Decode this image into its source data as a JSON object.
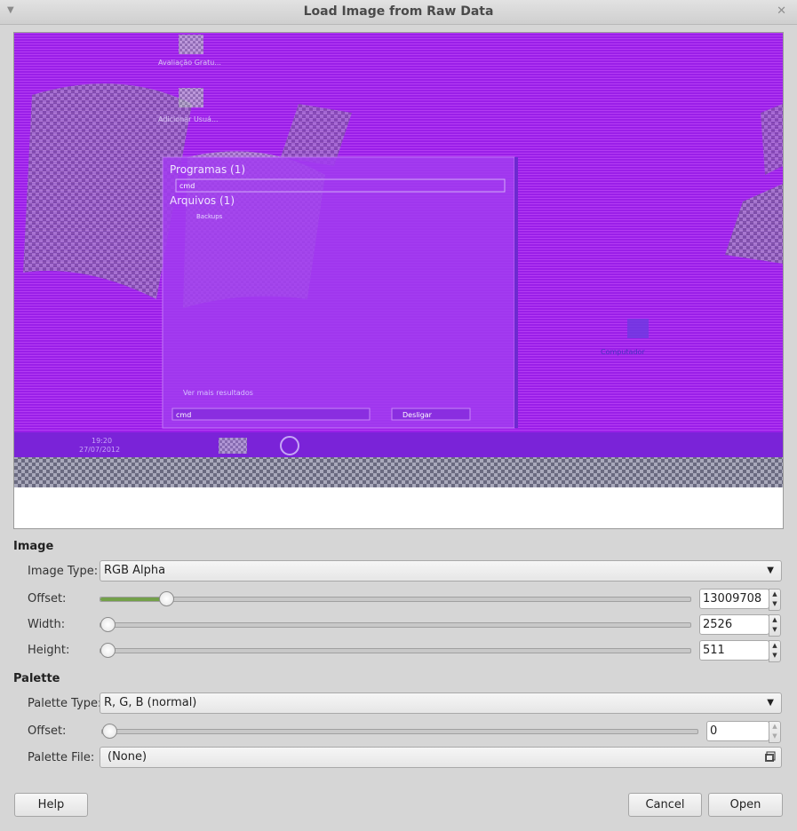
{
  "dialog": {
    "title": "Load Image from Raw Data",
    "menu_icon": "triangle-down-icon",
    "close_icon": "close-x-icon"
  },
  "preview": {
    "colors": {
      "primary": "#9a1fe8",
      "secondary": "#7a3ad8",
      "checker_light": "#b7b7c9",
      "checker_dark": "#5a5a6e"
    },
    "screen_texts": {
      "desktop_icon_1": "Avaliação Gratu...",
      "desktop_icon_2": "Adicionar Usuá...",
      "start_programs": "Programas (1)",
      "start_selected": "cmd",
      "start_files": "Arquivos (1)",
      "file_item": "Backups",
      "see_more": "Ver mais resultados",
      "search_box": "cmd",
      "shutdown": "Desligar",
      "taskbar_time": "19:20",
      "taskbar_date": "27/07/2012",
      "desktop_icon_3": "Computador"
    }
  },
  "image_section": {
    "header": "Image",
    "image_type_label": "Image Type:",
    "image_type_value": "RGB Alpha",
    "offset_label": "Offset:",
    "offset_value": "13009708",
    "offset_fraction": 0.1,
    "width_label": "Width:",
    "width_value": "2526",
    "width_fraction": 0.0,
    "height_label": "Height:",
    "height_value": "511",
    "height_fraction": 0.0
  },
  "palette_section": {
    "header": "Palette",
    "palette_type_label": "Palette Type:",
    "palette_type_value": "R, G, B (normal)",
    "offset_label": "Offset:",
    "offset_value": "0",
    "offset_fraction": 0.0,
    "palette_file_label": "Palette File:",
    "palette_file_value": "(None)",
    "file_icon": "file-chooser-icon"
  },
  "buttons": {
    "help": "Help",
    "cancel": "Cancel",
    "open": "Open"
  }
}
